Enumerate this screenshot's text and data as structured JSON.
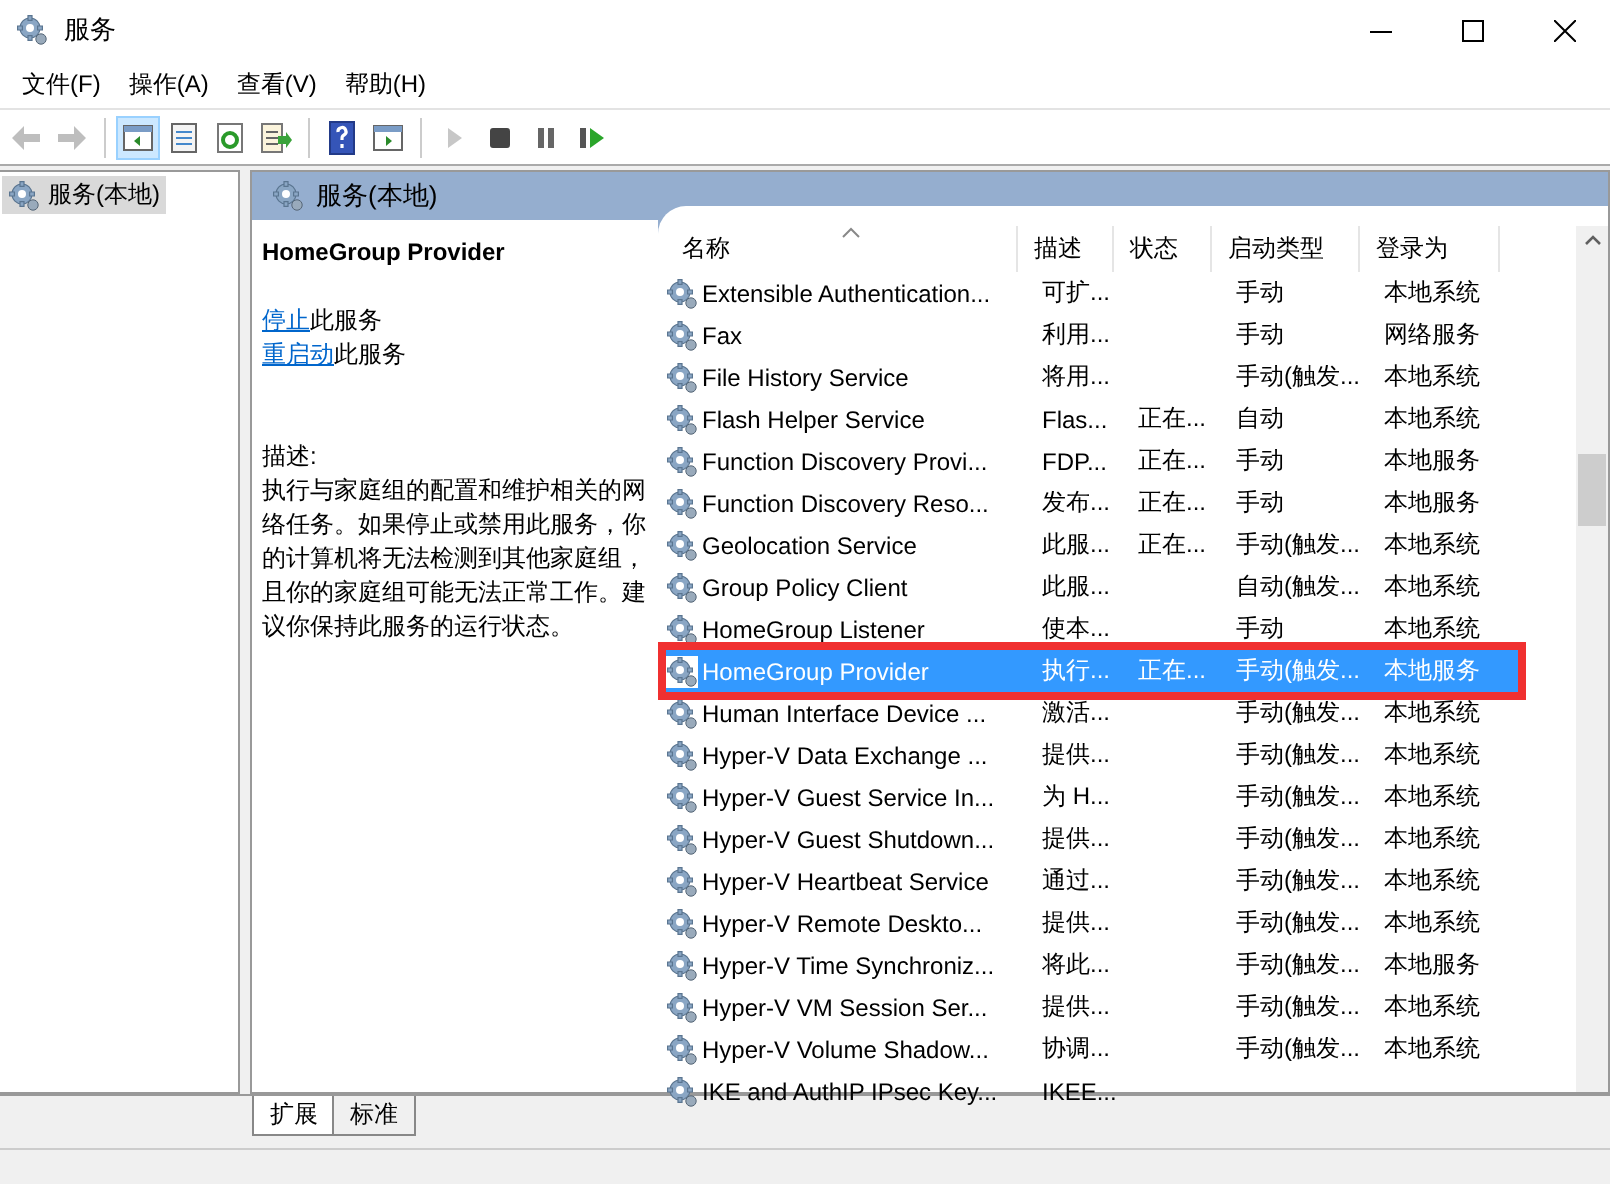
{
  "window": {
    "title": "服务"
  },
  "menu": [
    "文件(F)",
    "操作(A)",
    "查看(V)",
    "帮助(H)"
  ],
  "toolbar": [
    {
      "kind": "back",
      "disabled": true
    },
    {
      "kind": "forward",
      "disabled": true
    },
    {
      "kind": "tree",
      "pressed": true
    },
    {
      "kind": "properties",
      "pressed": false
    },
    {
      "kind": "refresh",
      "pressed": false
    },
    {
      "kind": "export",
      "pressed": false
    },
    {
      "kind": "help",
      "pressed": false
    },
    {
      "kind": "view",
      "pressed": false
    },
    {
      "kind": "play",
      "disabled": true
    },
    {
      "kind": "stop",
      "disabled": false
    },
    {
      "kind": "pause",
      "disabled": false
    },
    {
      "kind": "resume",
      "disabled": false
    }
  ],
  "tree": [
    {
      "label": "服务(本地)",
      "selected": true
    }
  ],
  "panel_title": "服务(本地)",
  "details": {
    "title": "HomeGroup Provider",
    "actions": [
      {
        "link": "停止",
        "text": "此服务"
      },
      {
        "link": "重启动",
        "text": "此服务"
      }
    ],
    "description_label": "描述:",
    "description": "执行与家庭组的配置和维护相关的网络任务。如果停止或禁用此服务，你的计算机将无法检测到其他家庭组，且你的家庭组可能无法正常工作。建议你保持此服务的运行状态。"
  },
  "table": {
    "columns": [
      "名称",
      "描述",
      "状态",
      "启动类型",
      "登录为"
    ],
    "rows": [
      {
        "name": "Extensible Authentication...",
        "description": "可扩...",
        "status": "",
        "startup": "手动",
        "logon": "本地系统",
        "selected": false,
        "callout": false
      },
      {
        "name": "Fax",
        "description": "利用...",
        "status": "",
        "startup": "手动",
        "logon": "网络服务",
        "selected": false,
        "callout": false
      },
      {
        "name": "File History Service",
        "description": "将用...",
        "status": "",
        "startup": "手动(触发...",
        "logon": "本地系统",
        "selected": false,
        "callout": false
      },
      {
        "name": "Flash Helper Service",
        "description": "Flas...",
        "status": "正在...",
        "startup": "自动",
        "logon": "本地系统",
        "selected": false,
        "callout": false
      },
      {
        "name": "Function Discovery Provi...",
        "description": "FDP...",
        "status": "正在...",
        "startup": "手动",
        "logon": "本地服务",
        "selected": false,
        "callout": false
      },
      {
        "name": "Function Discovery Reso...",
        "description": "发布...",
        "status": "正在...",
        "startup": "手动",
        "logon": "本地服务",
        "selected": false,
        "callout": false
      },
      {
        "name": "Geolocation Service",
        "description": "此服...",
        "status": "正在...",
        "startup": "手动(触发...",
        "logon": "本地系统",
        "selected": false,
        "callout": false
      },
      {
        "name": "Group Policy Client",
        "description": "此服...",
        "status": "",
        "startup": "自动(触发...",
        "logon": "本地系统",
        "selected": false,
        "callout": false
      },
      {
        "name": "HomeGroup Listener",
        "description": "使本...",
        "status": "",
        "startup": "手动",
        "logon": "本地系统",
        "selected": false,
        "callout": false
      },
      {
        "name": "HomeGroup Provider",
        "description": "执行...",
        "status": "正在...",
        "startup": "手动(触发...",
        "logon": "本地服务",
        "selected": true,
        "callout": true
      },
      {
        "name": "Human Interface Device ...",
        "description": "激活...",
        "status": "",
        "startup": "手动(触发...",
        "logon": "本地系统",
        "selected": false,
        "callout": false
      },
      {
        "name": "Hyper-V Data Exchange ...",
        "description": "提供...",
        "status": "",
        "startup": "手动(触发...",
        "logon": "本地系统",
        "selected": false,
        "callout": false
      },
      {
        "name": "Hyper-V Guest Service In...",
        "description": "为 H...",
        "status": "",
        "startup": "手动(触发...",
        "logon": "本地系统",
        "selected": false,
        "callout": false
      },
      {
        "name": "Hyper-V Guest Shutdown...",
        "description": "提供...",
        "status": "",
        "startup": "手动(触发...",
        "logon": "本地系统",
        "selected": false,
        "callout": false
      },
      {
        "name": "Hyper-V Heartbeat Service",
        "description": "通过...",
        "status": "",
        "startup": "手动(触发...",
        "logon": "本地系统",
        "selected": false,
        "callout": false
      },
      {
        "name": "Hyper-V Remote Deskto...",
        "description": "提供...",
        "status": "",
        "startup": "手动(触发...",
        "logon": "本地系统",
        "selected": false,
        "callout": false
      },
      {
        "name": "Hyper-V Time Synchroniz...",
        "description": "将此...",
        "status": "",
        "startup": "手动(触发...",
        "logon": "本地服务",
        "selected": false,
        "callout": false
      },
      {
        "name": "Hyper-V VM Session Ser...",
        "description": "提供...",
        "status": "",
        "startup": "手动(触发...",
        "logon": "本地系统",
        "selected": false,
        "callout": false
      },
      {
        "name": "Hyper-V Volume Shadow...",
        "description": "协调...",
        "status": "",
        "startup": "手动(触发...",
        "logon": "本地系统",
        "selected": false,
        "callout": false
      },
      {
        "name": "IKE and AuthIP IPsec Key...",
        "description": "IKEE...",
        "status": "",
        "startup": "",
        "logon": "",
        "selected": false,
        "callout": false
      }
    ]
  },
  "bottom_tabs": [
    {
      "label": "扩展",
      "selected": true
    },
    {
      "label": "标准",
      "selected": false
    }
  ]
}
